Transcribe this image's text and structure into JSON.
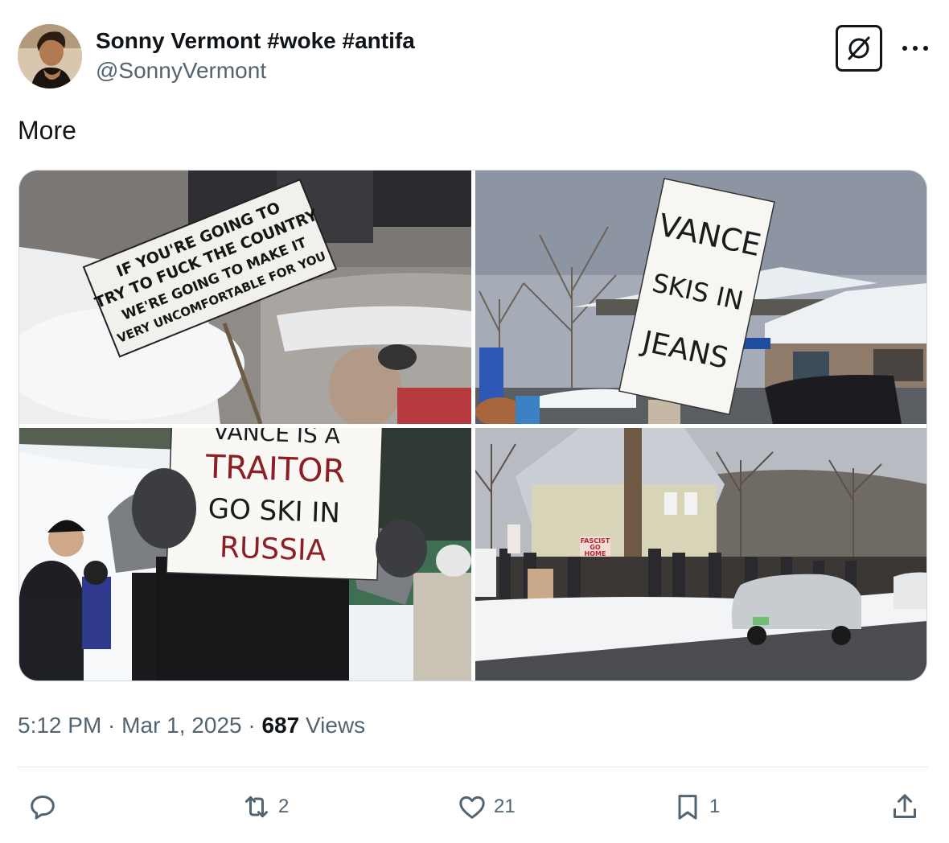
{
  "author": {
    "display_name": "Sonny Vermont #woke #antifa",
    "handle": "@SonnyVermont",
    "avatar_icon": "profile-photo-avatar"
  },
  "header_buttons": {
    "grok_icon": "grok-slash-icon",
    "more_icon": "more-dots-icon",
    "more_label": "···"
  },
  "tweet": {
    "text": "More"
  },
  "media": {
    "photos": [
      {
        "name": "photo-1",
        "sign_lines": [
          "IF YOU'RE GOING TO",
          "TRY TO FUCK THE COUNTRY",
          "WE'RE GOING TO MAKE IT",
          "VERY UNCOMFORTABLE FOR YOU"
        ]
      },
      {
        "name": "photo-2",
        "sign_lines": [
          "VANCE",
          "SKIS IN",
          "JEANS"
        ]
      },
      {
        "name": "photo-3",
        "sign_lines": [
          "VANCE IS A",
          "TRAITOR",
          "GO SKI IN",
          "RUSSIA"
        ]
      },
      {
        "name": "photo-4",
        "sign_lines": [
          "FASCIST",
          "GO",
          "HOME"
        ]
      }
    ]
  },
  "meta": {
    "time": "5:12 PM",
    "separator": " · ",
    "date": "Mar 1, 2025",
    "views_count": "687",
    "views_label": " Views"
  },
  "actions": {
    "reply": {
      "icon": "reply-icon",
      "count": ""
    },
    "repost": {
      "icon": "repost-icon",
      "count": "2"
    },
    "like": {
      "icon": "like-heart-icon",
      "count": "21"
    },
    "bookmark": {
      "icon": "bookmark-icon",
      "count": "1"
    },
    "share": {
      "icon": "share-icon",
      "count": ""
    }
  },
  "colors": {
    "text_primary": "#0f1419",
    "text_secondary": "#536471",
    "border": "#cfd9de"
  }
}
